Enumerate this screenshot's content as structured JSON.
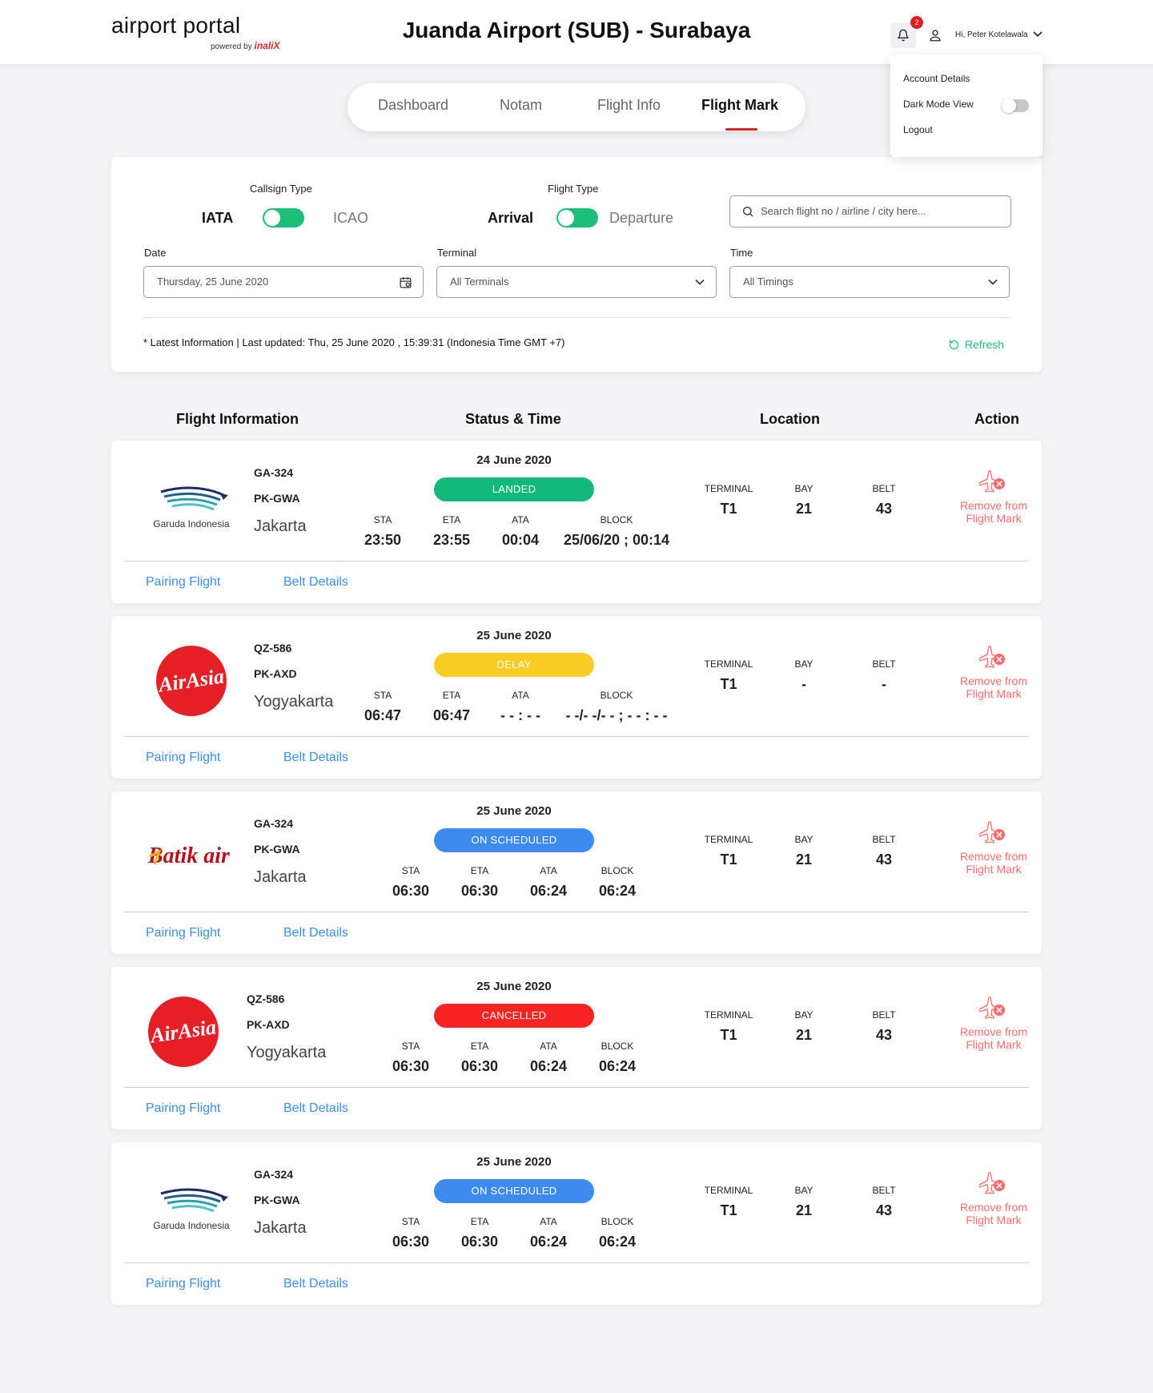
{
  "header": {
    "logo_main": "airport portal",
    "logo_powered": "powered by",
    "logo_brand": "inaliX",
    "airport_title": "Juanda Airport (SUB) - Surabaya",
    "notification_count": "2",
    "greeting": "Hi, Peter Kotelawala"
  },
  "user_menu": {
    "account_details": "Account Details",
    "dark_mode": "Dark Mode View",
    "logout": "Logout"
  },
  "nav": {
    "tabs": [
      "Dashboard",
      "Notam",
      "Flight Info",
      "Flight Mark"
    ],
    "active": "Flight Mark"
  },
  "filters": {
    "callsign_label": "Callsign Type",
    "callsign_on": "IATA",
    "callsign_off": "ICAO",
    "flight_type_label": "Flight Type",
    "flight_type_on": "Arrival",
    "flight_type_off": "Departure",
    "search_placeholder": "Search flight no / airline / city here...",
    "date_label": "Date",
    "date_value": "Thursday, 25 June 2020",
    "terminal_label": "Terminal",
    "terminal_value": "All Terminals",
    "time_label": "Time",
    "time_value": "All Timings",
    "updated_text": "* Latest Information | Last updated: Thu, 25 June 2020 , 15:39:31 (Indonesia Time GMT +7)",
    "refresh_label": "Refresh"
  },
  "columns": {
    "flight_info": "Flight Information",
    "status_time": "Status & Time",
    "location": "Location",
    "action": "Action"
  },
  "labels": {
    "sta": "STA",
    "eta": "ETA",
    "ata": "ATA",
    "block": "BLOCK",
    "terminal": "TERMINAL",
    "bay": "BAY",
    "belt": "BELT",
    "remove_line1": "Remove from",
    "remove_line2": "Flight Mark",
    "pairing": "Pairing Flight",
    "belt_details": "Belt Details",
    "garuda_text": "Garuda Indonesia",
    "airasia_text": "AirAsia",
    "batik_text": "Batik air"
  },
  "colors": {
    "accent_red": "#e02020",
    "green": "#1bbf7a",
    "landed": "#12b97a",
    "delay": "#f9cc24",
    "on_scheduled": "#3d8bef",
    "cancelled": "#f82424",
    "link_blue": "#3b8fe8",
    "remove_red": "#ff6b6b"
  },
  "flights": [
    {
      "airline": "garuda-indonesia",
      "flight_no": "GA-324",
      "reg": "PK-GWA",
      "city": "Jakarta",
      "date": "24 June 2020",
      "status": "LANDED",
      "sta": "23:50",
      "eta": "23:55",
      "ata": "00:04",
      "block": "25/06/20 ; 00:14",
      "terminal": "T1",
      "bay": "21",
      "belt": "43"
    },
    {
      "airline": "airasia",
      "flight_no": "QZ-586",
      "reg": "PK-AXD",
      "city": "Yogyakarta",
      "date": "25 June 2020",
      "status": "DELAY",
      "sta": "06:47",
      "eta": "06:47",
      "ata": "- - : - -",
      "block": "- -/- -/- - ; - - : - -",
      "terminal": "T1",
      "bay": "-",
      "belt": "-"
    },
    {
      "airline": "batik-air",
      "flight_no": "GA-324",
      "reg": "PK-GWA",
      "city": "Jakarta",
      "date": "25 June 2020",
      "status": "ON SCHEDULED",
      "sta": "06:30",
      "eta": "06:30",
      "ata": "06:24",
      "block": "06:24",
      "terminal": "T1",
      "bay": "21",
      "belt": "43"
    },
    {
      "airline": "airasia",
      "flight_no": "QZ-586",
      "reg": "PK-AXD",
      "city": "Yogyakarta",
      "date": "25 June 2020",
      "status": "CANCELLED",
      "sta": "06:30",
      "eta": "06:30",
      "ata": "06:24",
      "block": "06:24",
      "terminal": "T1",
      "bay": "21",
      "belt": "43"
    },
    {
      "airline": "garuda-indonesia",
      "flight_no": "GA-324",
      "reg": "PK-GWA",
      "city": "Jakarta",
      "date": "25 June 2020",
      "status": "ON SCHEDULED",
      "sta": "06:30",
      "eta": "06:30",
      "ata": "06:24",
      "block": "06:24",
      "terminal": "T1",
      "bay": "21",
      "belt": "43"
    }
  ]
}
